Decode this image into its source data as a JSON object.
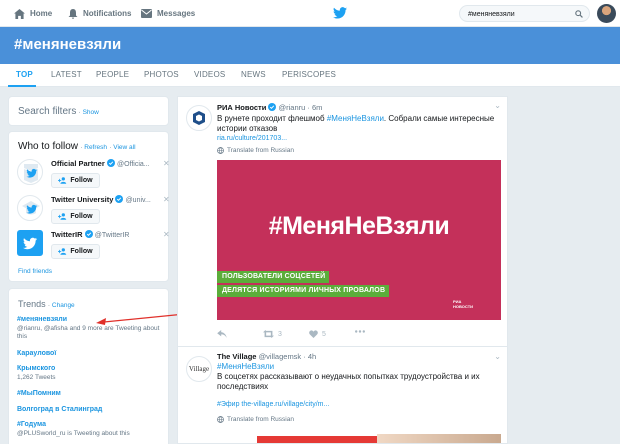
{
  "nav": {
    "home": "Home",
    "notifications": "Notifications",
    "messages": "Messages",
    "search_value": "#меняневзяли"
  },
  "banner": {
    "title": "#меняневзяли"
  },
  "tabs": [
    "TOP",
    "LATEST",
    "PEOPLE",
    "PHOTOS",
    "VIDEOS",
    "NEWS",
    "PERISCOPES"
  ],
  "search_filters": {
    "title": "Search filters",
    "show": "Show"
  },
  "who_to_follow": {
    "title": "Who to follow",
    "refresh": "Refresh",
    "view_all": "View all",
    "follow_label": "Follow",
    "find_friends": "Find friends",
    "items": [
      {
        "name": "Official Partner",
        "handle": "@Officia..."
      },
      {
        "name": "Twitter University",
        "handle": "@univ..."
      },
      {
        "name": "TwitterIR",
        "handle": "@TwitterIR"
      }
    ]
  },
  "trends": {
    "title": "Trends",
    "change": "Change",
    "items": [
      {
        "name": "#меняневзяли",
        "meta": "@rianru, @afisha and 9 more are Tweeting about this"
      },
      {
        "name": "Караулової",
        "meta": ""
      },
      {
        "name": "Крымского",
        "meta": "1,262 Tweets"
      },
      {
        "name": "#МыПомним",
        "meta": ""
      },
      {
        "name": "Волгоград в Сталинград",
        "meta": ""
      },
      {
        "name": "#Годума",
        "meta": "@PLUSworld_ru is Tweeting about this"
      }
    ]
  },
  "tweets": [
    {
      "name": "РИА Новости",
      "handle": "@rianru",
      "time": "6m",
      "text_before": "В рунете проходит флешмоб ",
      "hashtag": "#МеняНеВзяли",
      "text_after": ". Собрали самые интересные истории отказов",
      "link": "ria.ru/culture/201703...",
      "translate": "Translate from Russian",
      "media": {
        "title": "#МеняНеВзяли",
        "sub1": "ПОЛЬЗОВАТЕЛИ СОЦСЕТЕЙ",
        "sub2": "ДЕЛЯТСЯ ИСТОРИЯМИ ЛИЧНЫХ ПРОВАЛОВ",
        "logo_line1": "РИА",
        "logo_line2": "НОВОСТИ"
      },
      "retweets": "3",
      "likes": "5"
    },
    {
      "name": "The Village",
      "handle": "@villagemsk",
      "time": "4h",
      "hashtag": "#МеняНеВзяли",
      "text": "В соцсетях рассказывают о неудачных попытках трудоустройства и их последствиях",
      "link": "#Эфир the-village.ru/village/city/m...",
      "translate": "Translate from Russian",
      "avatar_text": "Village"
    }
  ],
  "colors": {
    "twitter_blue": "#1da1f2",
    "banner": "#4a90d9",
    "media_bg": "#c4305a",
    "media_green": "#5bad3a",
    "arrow": "#e0302a"
  }
}
